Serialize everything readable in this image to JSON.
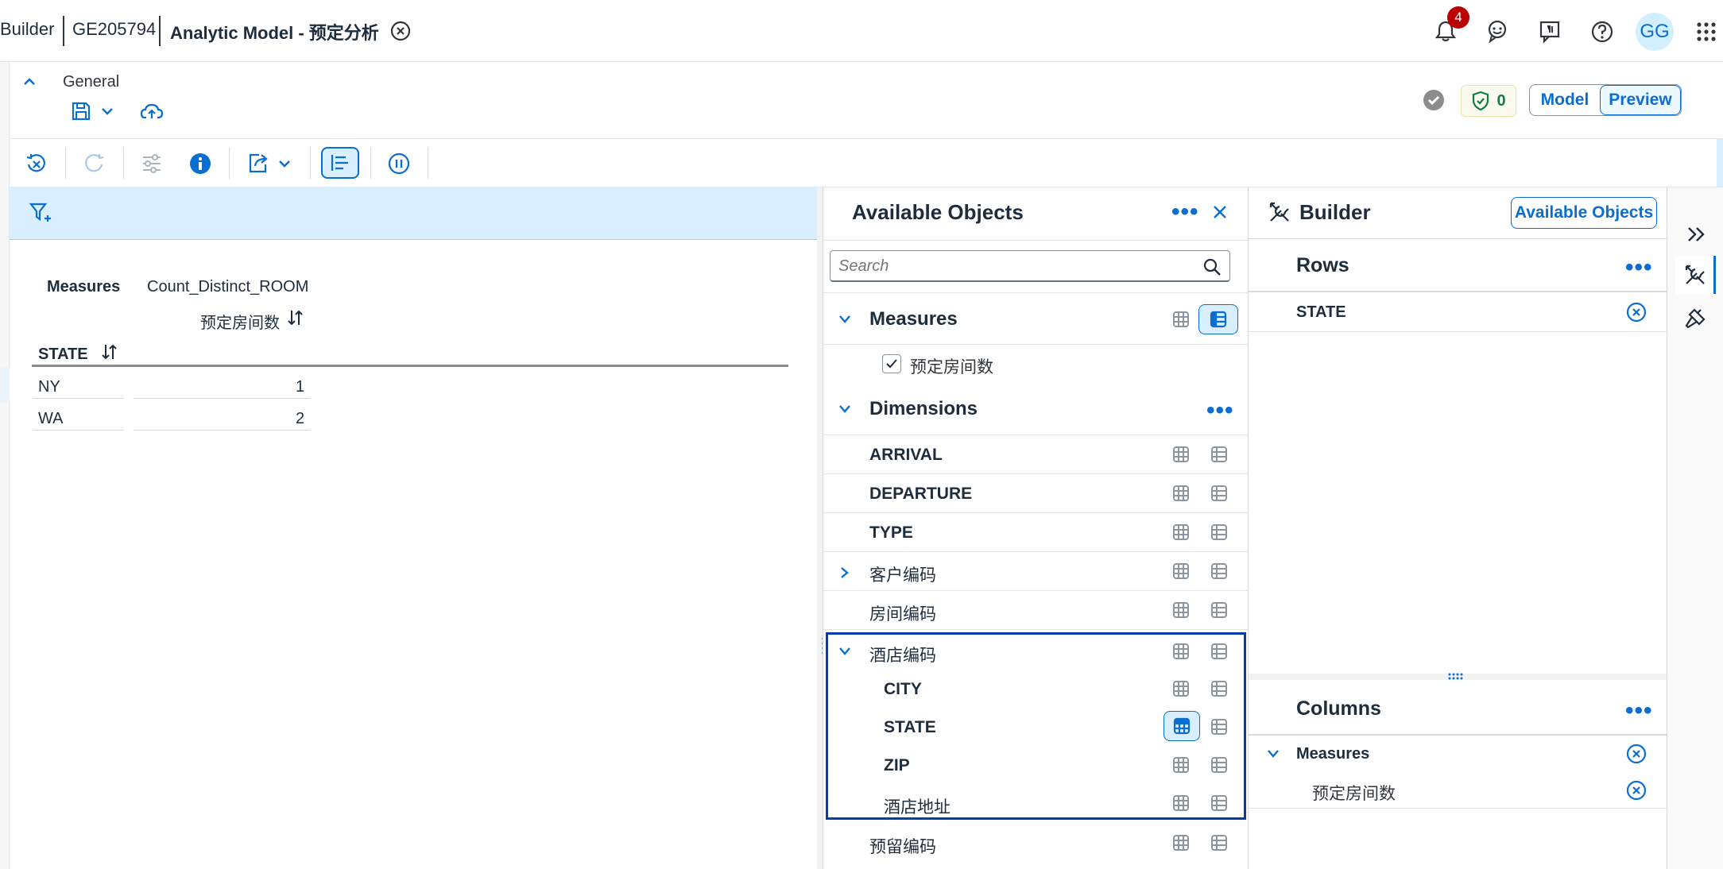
{
  "shell": {
    "crumbs": [
      "Builder",
      "GE205794",
      "Analytic Model - 预定分析"
    ],
    "notification_count": "4",
    "user_initials": "GG"
  },
  "header": {
    "section_title": "General",
    "validation_count": "0",
    "mode_model": "Model",
    "mode_preview": "Preview"
  },
  "preview": {
    "measures_label": "Measures",
    "measures_value": "Count_Distinct_ROOM",
    "measure_column": "预定房间数",
    "dimension_column": "STATE",
    "rows": [
      {
        "state": "NY",
        "value": "1"
      },
      {
        "state": "WA",
        "value": "2"
      }
    ]
  },
  "available": {
    "title": "Available Objects",
    "search_placeholder": "Search",
    "measures_heading": "Measures",
    "measures": [
      "预定房间数"
    ],
    "dimensions_heading": "Dimensions",
    "dimensions": [
      "ARRIVAL",
      "DEPARTURE",
      "TYPE",
      "客户编码",
      "房间编码",
      "酒店编码"
    ],
    "hotel_children": [
      "CITY",
      "STATE",
      "ZIP",
      "酒店地址"
    ],
    "last_item": "预留编码"
  },
  "builder": {
    "title": "Builder",
    "available_button": "Available Objects",
    "rows_heading": "Rows",
    "rows": [
      "STATE"
    ],
    "columns_heading": "Columns",
    "columns_group": "Measures",
    "columns_items": [
      "预定房间数"
    ]
  },
  "colors": {
    "accent": "#0a6ed1",
    "filterbar": "#d9efff",
    "selection_border": "#0a3ca8",
    "positive": "#107e3e",
    "badge": "#bb0000"
  }
}
